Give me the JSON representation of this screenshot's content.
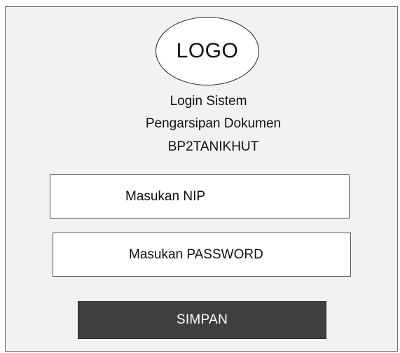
{
  "logo": {
    "text": "LOGO"
  },
  "title": {
    "line1": "Login Sistem",
    "line2": "Pengarsipan Dokumen",
    "line3": "BP2TANIKHUT"
  },
  "form": {
    "nip_placeholder": "Masukan NIP",
    "password_placeholder": "Masukan PASSWORD",
    "submit_label": "SIMPAN"
  },
  "colors": {
    "frame_background": "#f2f2f2",
    "button_background": "#3f3f3f",
    "button_text": "#ffffff"
  }
}
